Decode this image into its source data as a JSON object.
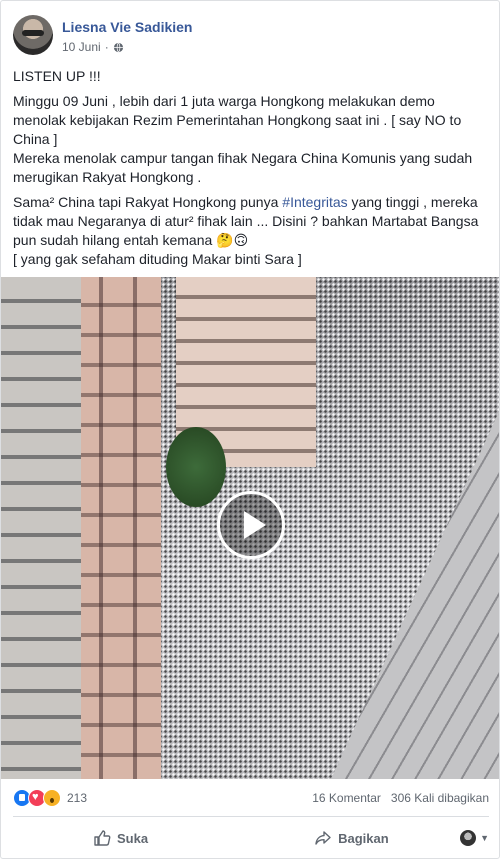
{
  "post": {
    "author": "Liesna Vie Sadikien",
    "date": "10 Juni",
    "dot": "·",
    "icon": "globe-icon",
    "paragraphs": [
      "LISTEN UP !!!",
      "Minggu 09 Juni , lebih dari 1 juta warga Hongkong melakukan demo menolak kebijakan Rezim Pemerintahan Hongkong saat ini . [ say NO to China ]\nMereka menolak campur tangan fihak Negara China Komunis yang sudah merugikan Rakyat Hongkong ."
    ],
    "p3_before": "Sama² China tapi Rakyat Hongkong punya ",
    "hashtag": "#Integritas",
    "p3_after": " yang tinggi , mereka tidak mau Negaranya di atur² fihak lain ... Disini ? bahkan Martabat Bangsa pun sudah hilang entah kemana 🤔🙃\n[ yang gak sefaham dituding Makar binti Sara ]"
  },
  "video": {
    "play_icon": "play-icon"
  },
  "stats": {
    "reaction_count": "213",
    "comments": "16 Komentar",
    "shares": "306 Kali dibagikan",
    "reaction_colors": {
      "like": "#1877f2",
      "love": "#f33e58",
      "wow": "#f7b125"
    }
  },
  "actions": {
    "like": "Suka",
    "share": "Bagikan"
  }
}
